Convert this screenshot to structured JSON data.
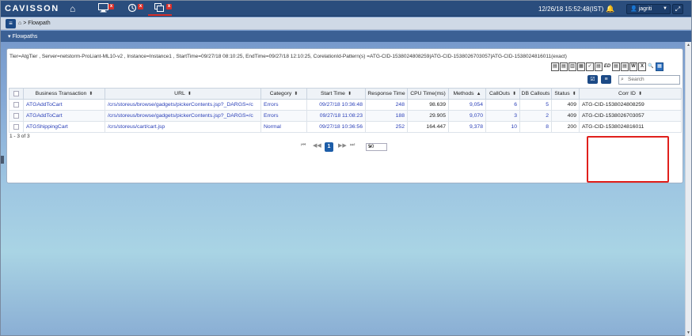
{
  "app": {
    "logo": "CAVISSON"
  },
  "topbar": {
    "datetime": "12/26/18 15:52:48(IST)",
    "user": "jagriti",
    "badge_x": "x"
  },
  "breadcrumb": {
    "current": "Flowpath"
  },
  "section": {
    "title": "Flowpaths"
  },
  "filter": {
    "text": "Tier=AtgTier , Server=netstorm-ProLiant-ML10-v2 , Instance=Instance1 , StartTime=09/27/18 08:10:25, EndTime=09/27/18 12:10:25, CorelationId-Pattern(s) =ATG-CID-1538024808259|ATG-CID-1538026703057|ATG-CID-1538024816011(exact)"
  },
  "export_icons": [
    "pdf-icon",
    "doc-icon",
    "copy-icon",
    "paste-icon",
    "check-icon",
    "doc2-icon",
    "ed-icon",
    "doc3-icon",
    "pdf2-icon",
    "word-icon",
    "excel-icon",
    "zoom-icon",
    "grid-icon"
  ],
  "search": {
    "placeholder": "Search"
  },
  "table": {
    "columns": [
      {
        "label": "",
        "sortable": false
      },
      {
        "label": "Business Transaction",
        "sortable": true
      },
      {
        "label": "URL",
        "sortable": true
      },
      {
        "label": "Category",
        "sortable": true
      },
      {
        "label": "Start Time",
        "sortable": true
      },
      {
        "label": "Response Time",
        "sortable": false
      },
      {
        "label": "CPU Time(ms)",
        "sortable": false
      },
      {
        "label": "Methods",
        "sortable": true,
        "sort": "asc"
      },
      {
        "label": "CallOuts",
        "sortable": true
      },
      {
        "label": "DB Callouts",
        "sortable": false
      },
      {
        "label": "Status",
        "sortable": true
      },
      {
        "label": "Corr ID",
        "sortable": true
      }
    ],
    "rows": [
      {
        "bt": "ATGAddToCart",
        "url": "/crs/storeus/browse/gadgets/pickerContents.jsp?_DARGS=/c",
        "category": "Errors",
        "start": "09/27/18 10:36:48",
        "resp": "248",
        "cpu": "98.639",
        "methods": "9,054",
        "callouts": "6",
        "db": "5",
        "status": "409",
        "corr": "ATG-CID-1538024808259"
      },
      {
        "bt": "ATGAddToCart",
        "url": "/crs/storeus/browse/gadgets/pickerContents.jsp?_DARGS=/c",
        "category": "Errors",
        "start": "09/27/18 11:08:23",
        "resp": "188",
        "cpu": "29.905",
        "methods": "9,070",
        "callouts": "3",
        "db": "2",
        "status": "409",
        "corr": "ATG-CID-1538026703057"
      },
      {
        "bt": "ATGShippingCart",
        "url": "/crs/storeus/cart/cart.jsp",
        "category": "Normal",
        "start": "09/27/18 10:36:56",
        "resp": "252",
        "cpu": "164.447",
        "methods": "9,378",
        "callouts": "10",
        "db": "8",
        "status": "200",
        "corr": "ATG-CID-1538024816011"
      }
    ],
    "count_text": "1 - 3 of 3"
  },
  "pager": {
    "first": "⏮",
    "prev": "◀◀",
    "current": "1",
    "next": "▶▶",
    "last": "⏭",
    "page_size": "50"
  }
}
